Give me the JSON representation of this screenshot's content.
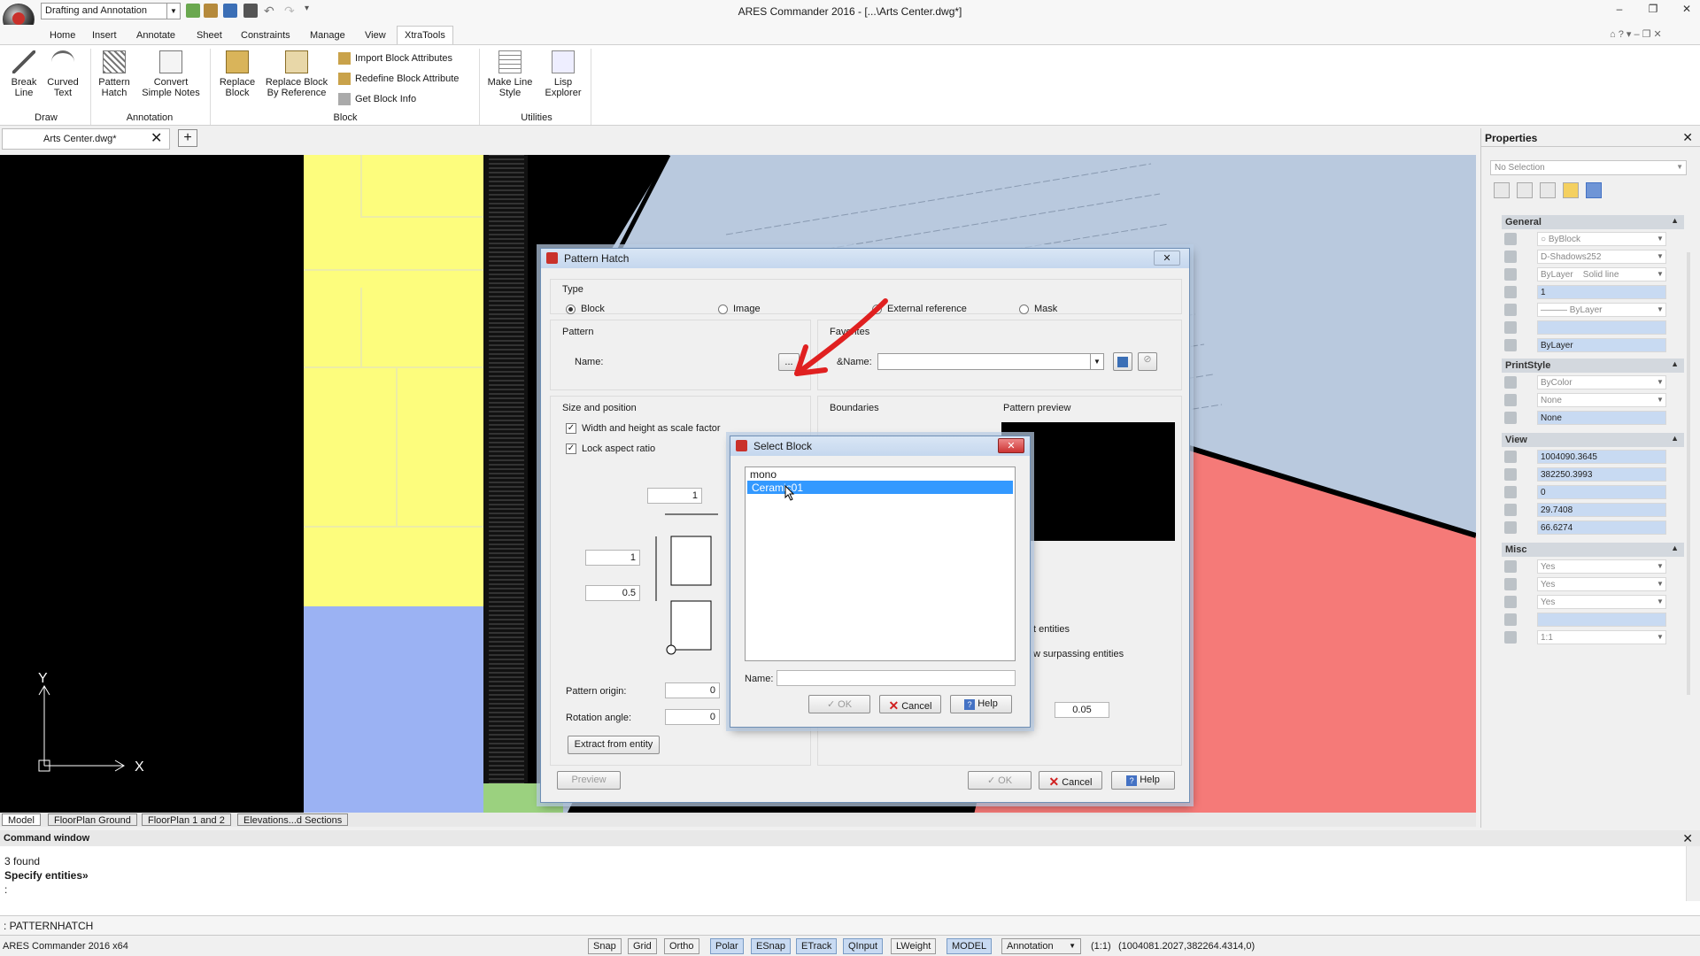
{
  "app": {
    "title": "ARES Commander 2016 - [...\\Arts Center.dwg*]",
    "workspace": "Drafting and Annotation"
  },
  "menu": [
    "Home",
    "Insert",
    "Annotate",
    "Sheet",
    "Constraints",
    "Manage",
    "View",
    "XtraTools"
  ],
  "menu_active": "XtraTools",
  "ribbon": {
    "draw": {
      "label": "Draw",
      "break": "Break\nLine",
      "curved": "Curved\nText"
    },
    "annotation": {
      "label": "Annotation",
      "hatch": "Pattern\nHatch",
      "convert": "Convert\nSimple Notes"
    },
    "block": {
      "label": "Block",
      "replace": "Replace\nBlock",
      "replace_ref": "Replace Block\nBy Reference",
      "import_attr": "Import Block Attributes",
      "redefine_attr": "Redefine Block Attribute",
      "get_info": "Get Block Info"
    },
    "utilities": {
      "label": "Utilities",
      "linestyle": "Make Line\nStyle",
      "lisp": "Lisp\nExplorer"
    }
  },
  "doc_tab": "Arts Center.dwg*",
  "sheet_tabs": [
    "Model",
    "FloorPlan Ground",
    "FloorPlan 1 and 2",
    "Elevations...d Sections"
  ],
  "ucs": {
    "x": "X",
    "y": "Y"
  },
  "pattern_hatch": {
    "title": "Pattern Hatch",
    "type_label": "Type",
    "types": [
      "Block",
      "Image",
      "External reference",
      "Mask"
    ],
    "pattern_label": "Pattern",
    "name_label": "Name:",
    "browse": "...",
    "favorites_label": "Favorites",
    "fav_name_label": "&Name:",
    "size_label": "Size and position",
    "scale_factor": "Width and height as scale factor",
    "lock_aspect": "Lock aspect ratio",
    "width_val": "1",
    "height_val": "1",
    "gap_val": "0.5",
    "origin_label": "Pattern origin:",
    "origin_val": "0",
    "rotation_label": "Rotation angle:",
    "rotation_val": "0",
    "extract": "Extract from entity",
    "boundaries_label": "Boundaries",
    "preview_label": "Pattern preview",
    "entities_text": "t entities",
    "surpassing_text": "w surpassing entities",
    "gap_value": "0.05",
    "preview_btn": "Preview",
    "ok": "OK",
    "cancel": "Cancel",
    "help": "Help"
  },
  "select_block": {
    "title": "Select Block",
    "items": [
      "mono",
      "Ceramic01"
    ],
    "selected_index": 1,
    "name_label": "Name:",
    "ok": "OK",
    "cancel": "Cancel",
    "help": "Help"
  },
  "properties": {
    "title": "Properties",
    "selection": "No Selection",
    "sections": {
      "general": "General",
      "printstyle": "PrintStyle",
      "view": "View",
      "misc": "Misc"
    },
    "general": [
      "ByBlock",
      "D-Shadows252",
      "ByLayer    Solid line",
      "1",
      "——— ByLayer",
      "",
      "ByLayer"
    ],
    "printstyle": [
      "ByColor",
      "None",
      "None"
    ],
    "view": [
      "1004090.3645",
      "382250.3993",
      "0",
      "29.7408",
      "66.6274"
    ],
    "misc": [
      "Yes",
      "Yes",
      "Yes",
      "",
      "1:1"
    ]
  },
  "command": {
    "title": "Command window",
    "lines": [
      "3 found",
      "Specify entities»",
      ":"
    ],
    "input": ": PATTERNHATCH"
  },
  "status": {
    "app": "ARES Commander 2016 x64",
    "buttons": [
      "Snap",
      "Grid",
      "Ortho",
      "Polar",
      "ESnap",
      "ETrack",
      "QInput",
      "LWeight",
      "MODEL"
    ],
    "on": [
      "Polar",
      "ESnap",
      "ETrack",
      "QInput",
      "MODEL"
    ],
    "annotation": "Annotation",
    "scale": "(1:1)",
    "coords": "(1004081.2027,382264.4314,0)"
  }
}
